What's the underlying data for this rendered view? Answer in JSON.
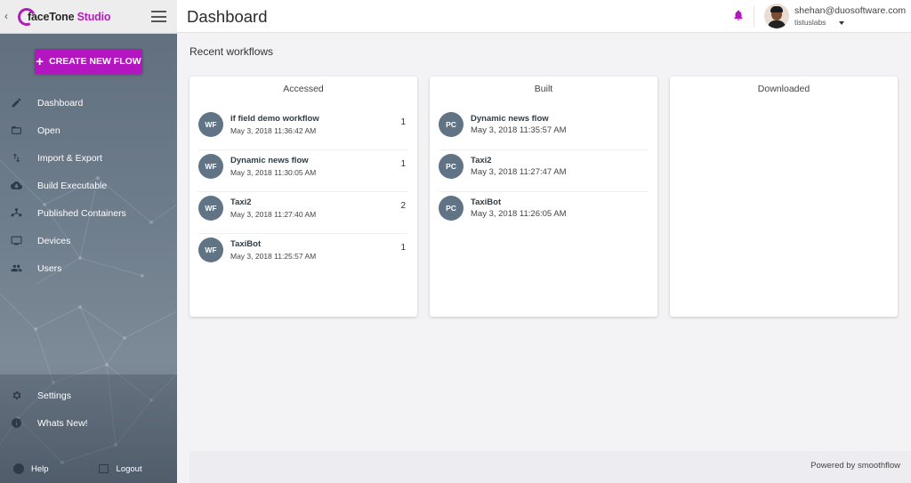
{
  "sidebar": {
    "back_glyph": "‹",
    "logo": {
      "brand": "faceTone",
      "studio": "Studio"
    },
    "create_button": "CREATE NEW FLOW",
    "items": [
      {
        "label": "Dashboard",
        "icon": "pencil-icon"
      },
      {
        "label": "Open",
        "icon": "folder-icon"
      },
      {
        "label": "Import & Export",
        "icon": "import-export-icon"
      },
      {
        "label": "Build Executable",
        "icon": "cloud-download-icon"
      },
      {
        "label": "Published Containers",
        "icon": "hub-icon"
      },
      {
        "label": "Devices",
        "icon": "devices-icon"
      },
      {
        "label": "Users",
        "icon": "users-icon"
      }
    ],
    "bottom_items": [
      {
        "label": "Settings",
        "icon": "gear-icon"
      },
      {
        "label": "Whats New!",
        "icon": "info-icon"
      }
    ],
    "help_label": "Help",
    "logout_label": "Logout"
  },
  "header": {
    "title": "Dashboard",
    "user_email": "shehan@duosoftware.com",
    "user_org": "tistuslabs"
  },
  "main": {
    "section_title": "Recent workflows",
    "cards": [
      {
        "title": "Accessed",
        "rows": [
          {
            "badge": "WF",
            "name": "if field demo workflow",
            "date": "May 3, 2018 11:36:42 AM",
            "count": "1"
          },
          {
            "badge": "WF",
            "name": "Dynamic news flow",
            "date": "May 3, 2018 11:30:05 AM",
            "count": "1"
          },
          {
            "badge": "WF",
            "name": "Taxi2",
            "date": "May 3, 2018 11:27:40 AM",
            "count": "2"
          },
          {
            "badge": "WF",
            "name": "TaxiBot",
            "date": "May 3, 2018 11:25:57 AM",
            "count": "1"
          }
        ]
      },
      {
        "title": "Built",
        "rows": [
          {
            "badge": "PC",
            "name": "Dynamic news flow",
            "date": "May 3, 2018 11:35:57 AM"
          },
          {
            "badge": "PC",
            "name": "Taxi2",
            "date": "May 3, 2018 11:27:47 AM"
          },
          {
            "badge": "PC",
            "name": "TaxiBot",
            "date": "May 3, 2018 11:26:05 AM"
          }
        ]
      },
      {
        "title": "Downloaded",
        "rows": []
      }
    ]
  },
  "footer": {
    "text": "Powered by smoothflow"
  },
  "colors": {
    "accent": "#b315c0",
    "badge": "#607486",
    "sidebar": "#6e7d8c"
  }
}
